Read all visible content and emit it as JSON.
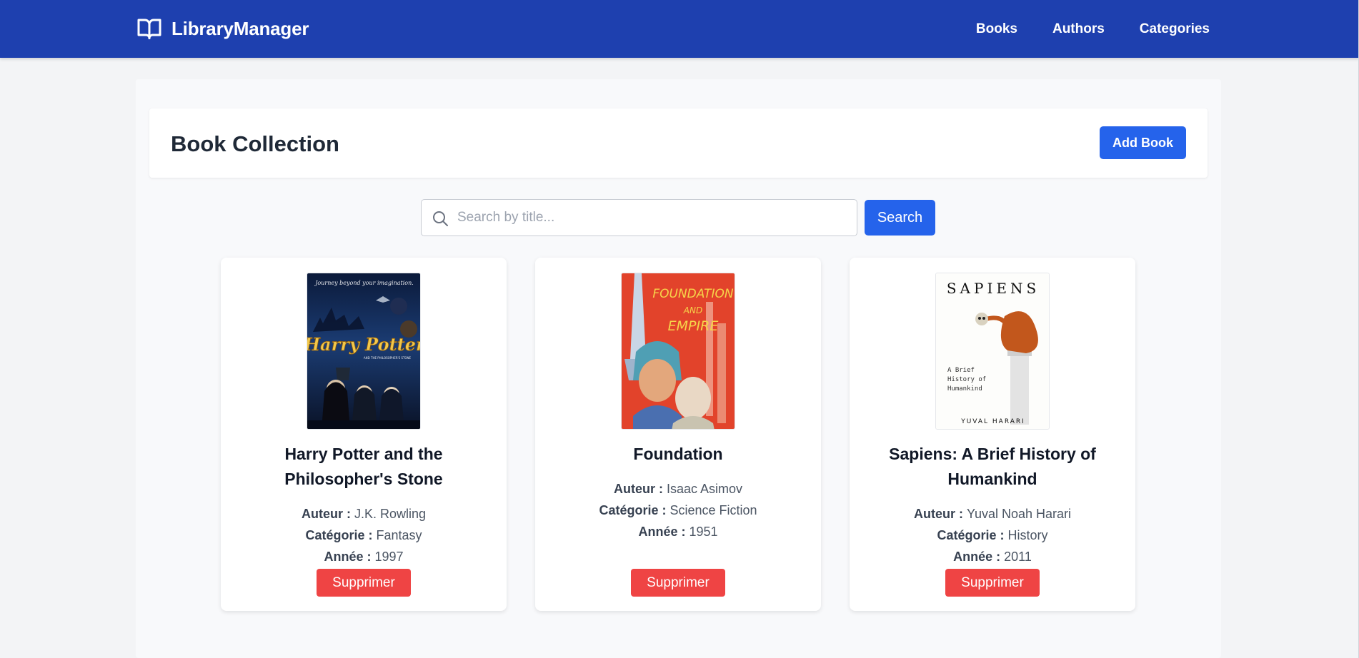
{
  "brand": {
    "icon": "book-open-icon",
    "name": "LibraryManager"
  },
  "nav": {
    "items": [
      "Books",
      "Authors",
      "Categories"
    ]
  },
  "header": {
    "title": "Book Collection",
    "add_button": "Add Book"
  },
  "search": {
    "icon": "search-icon",
    "placeholder": "Search by title...",
    "button": "Search"
  },
  "labels": {
    "author": "Auteur",
    "category": "Catégorie",
    "year": "Année",
    "delete": "Supprimer"
  },
  "books": [
    {
      "title": "Harry Potter and the Philosopher's Stone",
      "author": "J.K. Rowling",
      "category": "Fantasy",
      "year": "1997",
      "cover": {
        "tagline": "Journey beyond your imagination.",
        "title_text": "Harry Potter",
        "subtitle_text": "AND THE PHILOSOPHER'S STONE"
      }
    },
    {
      "title": "Foundation",
      "author": "Isaac Asimov",
      "category": "Science Fiction",
      "year": "1951",
      "cover": {
        "line1": "FOUNDATION",
        "line2": "AND",
        "line3": "EMPIRE"
      }
    },
    {
      "title": "Sapiens: A Brief History of Humankind",
      "author": "Yuval Noah Harari",
      "category": "History",
      "year": "2011",
      "cover": {
        "title_text": "SAPIENS",
        "line1": "A Brief",
        "line2": "History of",
        "line3": "Humankind",
        "author_text": "YUVAL HARARI"
      }
    }
  ],
  "colors": {
    "navbar": "#1e40af",
    "primary": "#2563eb",
    "danger": "#ef4444",
    "background": "#f3f4f6"
  }
}
